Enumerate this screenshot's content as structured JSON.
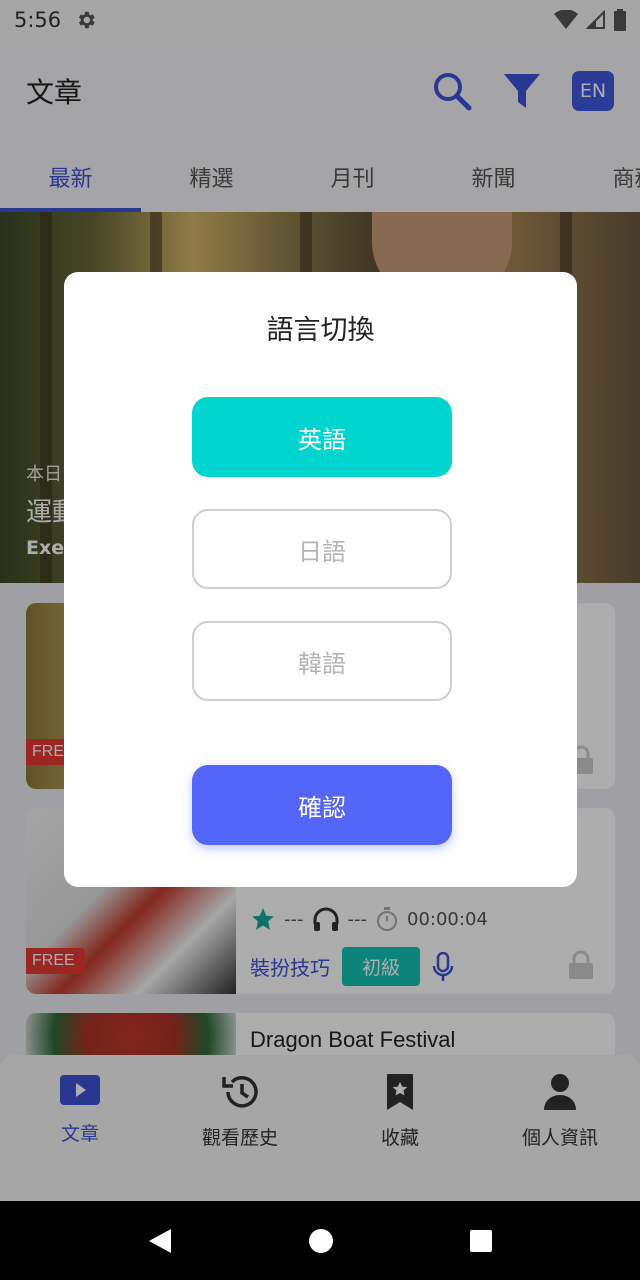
{
  "status_bar": {
    "time": "5:56"
  },
  "app_bar": {
    "title": "文章",
    "lang_badge": "EN"
  },
  "tabs": [
    {
      "label": "最新",
      "active": true
    },
    {
      "label": "精選",
      "active": false
    },
    {
      "label": "月刊",
      "active": false
    },
    {
      "label": "新聞",
      "active": false
    },
    {
      "label": "商務",
      "active": false
    }
  ],
  "hero": {
    "date_partial": "本日",
    "title_partial": "運動",
    "subtitle_partial": "Exer"
  },
  "cards": [
    {
      "free_label": "FREE"
    },
    {
      "free_label": "FREE",
      "rating": "---",
      "listens": "---",
      "duration": "00:00:04",
      "tag": "裝扮技巧",
      "level": "初級"
    },
    {
      "title": "Dragon Boat Festival"
    }
  ],
  "bottom_nav": [
    {
      "label": "文章",
      "icon": "play-video-icon",
      "active": true
    },
    {
      "label": "觀看歷史",
      "icon": "history-icon",
      "active": false
    },
    {
      "label": "收藏",
      "icon": "bookmark-star-icon",
      "active": false
    },
    {
      "label": "個人資訊",
      "icon": "person-icon",
      "active": false
    }
  ],
  "dialog": {
    "title": "語言切換",
    "options": [
      {
        "label": "英語",
        "selected": true
      },
      {
        "label": "日語",
        "selected": false
      },
      {
        "label": "韓語",
        "selected": false
      }
    ],
    "confirm_label": "確認"
  },
  "colors": {
    "accent": "#3f51d6",
    "selected_option": "#00d6cf",
    "confirm": "#5465f9",
    "free_badge": "#e53935",
    "level_badge": "#14c3b3"
  }
}
